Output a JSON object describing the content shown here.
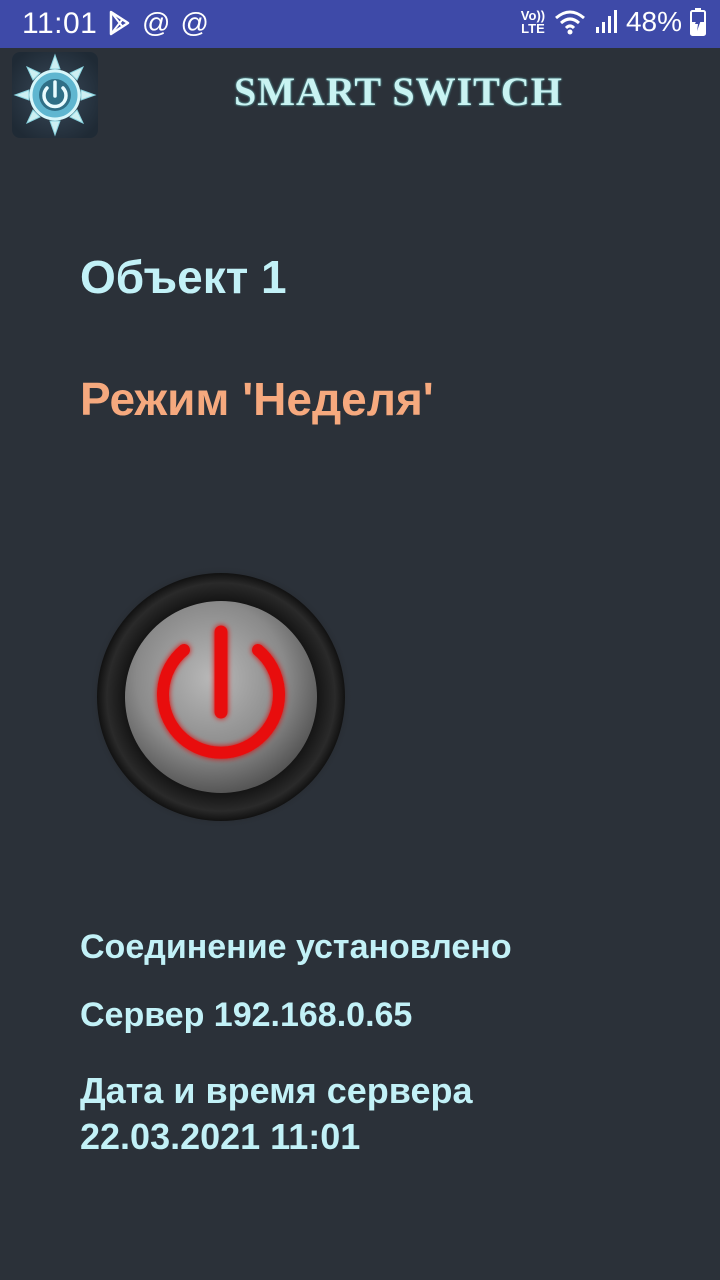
{
  "status_bar": {
    "time": "11:01",
    "battery_percent": "48%",
    "volte_line1": "Vo))",
    "volte_line2": "LTE",
    "icons": [
      "play-store-icon",
      "at-sign-icon",
      "at-sign-icon",
      "wifi-icon",
      "signal-icon",
      "battery-charging-icon"
    ]
  },
  "header": {
    "title": "SMART SWITCH",
    "logo_icon": "sun-power-logo-icon"
  },
  "main": {
    "object_name": "Объект 1",
    "mode": "Режим 'Неделя'",
    "power_button_icon": "power-icon",
    "power_state_color": "#e81010"
  },
  "info": {
    "connection": "Соединение установлено",
    "server": "Сервер 192.168.0.65",
    "datetime_label": "Дата и время сервера",
    "datetime_value": "22.03.2021 11:01"
  },
  "colors": {
    "background": "#2b3139",
    "status_bar": "#3e4aa8",
    "primary_text": "#c2f1f7",
    "mode_text": "#f6a97e"
  }
}
